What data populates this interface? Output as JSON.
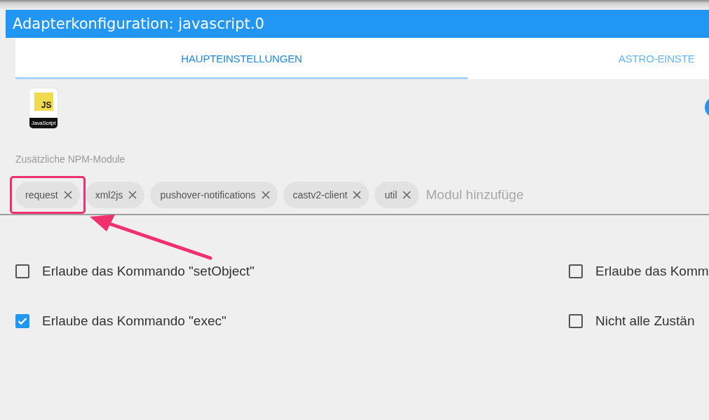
{
  "window": {
    "title": "Adapterkonfiguration: javascript.0"
  },
  "tabs": [
    {
      "label": "HAUPTEINSTELLUNGEN",
      "selected": true
    },
    {
      "label": "ASTRO-EINSTE",
      "selected": false
    }
  ],
  "logo": {
    "badge": "JS",
    "caption": "JavaScript"
  },
  "npm_modules": {
    "label": "Zusätzliche NPM-Module",
    "placeholder": "Modul hinzufüge",
    "chips": [
      {
        "label": "request",
        "highlighted": true
      },
      {
        "label": "xml2js",
        "highlighted": false
      },
      {
        "label": "pushover-notifications",
        "highlighted": false
      },
      {
        "label": "castv2-client",
        "highlighted": false
      },
      {
        "label": "util",
        "highlighted": false
      }
    ]
  },
  "options": [
    {
      "label": "Erlaube das Kommando \"setObject\"",
      "checked": false
    },
    {
      "label": "Erlaube das Komm",
      "checked": false
    },
    {
      "label": "Erlaube das Kommando \"exec\"",
      "checked": true
    },
    {
      "label": "Nicht alle Zustän",
      "checked": false
    }
  ]
}
